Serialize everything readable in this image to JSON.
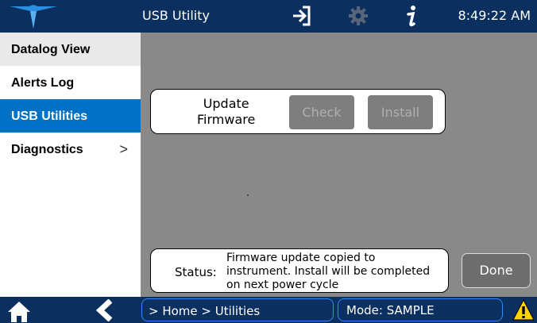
{
  "header": {
    "title": "USB Utility",
    "time": "8:49:22 AM",
    "icons": [
      "logo-icon",
      "sign-in-icon",
      "gear-icon",
      "info-icon"
    ]
  },
  "sidebar": {
    "items": [
      {
        "label": "Datalog View"
      },
      {
        "label": "Alerts Log"
      },
      {
        "label": "USB Utilities"
      },
      {
        "label": "Diagnostics",
        "chevron": ">"
      }
    ],
    "active": "USB Utilities"
  },
  "main": {
    "update_label_line1": "Update",
    "update_label_line2": "Firmware",
    "check_label": "Check",
    "install_label": "Install",
    "status_label": "Status:",
    "status_text": "Firmware update copied to instrument. Install will be completed on next power cycle",
    "done_label": "Done"
  },
  "footer": {
    "breadcrumb": "> Home > Utilities",
    "mode": "Mode: SAMPLE",
    "icons": [
      "home-icon",
      "back-icon",
      "warning-icon"
    ]
  },
  "colors": {
    "navy": "#0b2f5e",
    "accent_blue": "#0071c5",
    "panel_gray": "#898989",
    "warning_yellow": "#ffd400"
  }
}
